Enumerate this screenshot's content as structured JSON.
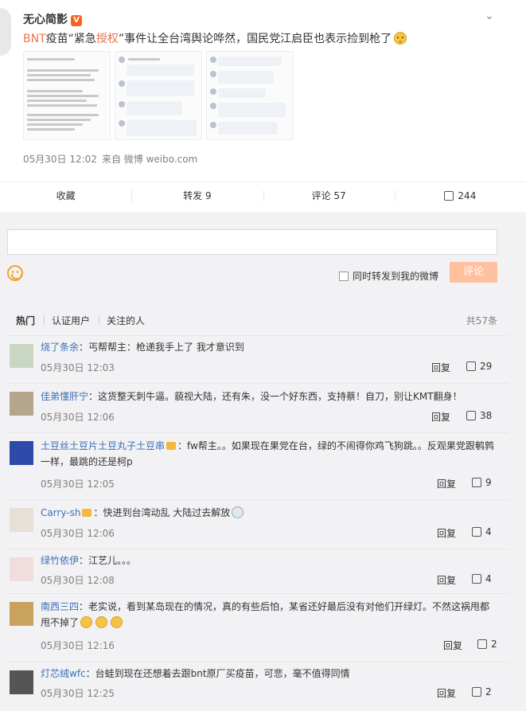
{
  "post": {
    "author": "无心简影",
    "badge": "V",
    "headline_prefix": "BNT",
    "headline_mid1": "疫苗“紧急",
    "headline_hl": "授权",
    "headline_rest": "”事件让全台湾舆论哗然，国民党江启臣也表示捡到枪了",
    "timestamp": "05月30日 12:02",
    "source": "来自 微博 weibo.com",
    "thumb1_text": "及接能急接權使用。反與接量正是否而Moderna 都會在說明中來建已通過檢經緊急授權使用。請問舞時事發者：請與和台製時 Pfizer-BioNTech疫苗送不肯已經請勿緊急授權使用？為什麼是BModerna 疫苗未通過期接緊急授權使用？"
  },
  "actions": {
    "collect": "收藏",
    "repost": "转发 9",
    "comment": "评论 57",
    "like": "244"
  },
  "composer": {
    "forward_label": "同时转发到我的微博",
    "submit_label": "评论"
  },
  "sort": {
    "hot": "热门",
    "verified": "认证用户",
    "following": "关注的人",
    "total": "共57条"
  },
  "comments": [
    {
      "user": "烧了条余",
      "text": "：丐帮帮主：枪递我手上了 我才意识到",
      "time": "05月30日 12:03",
      "reply": "回复",
      "likes": "29"
    },
    {
      "user": "佳弟懂肝宁",
      "text": "：这货整天刺牛逼。藐视大陆，还有朱，没一个好东西，支持蔡！自刀，别让KMT翻身！",
      "time": "05月30日 12:06",
      "reply": "回复",
      "likes": "38"
    },
    {
      "user": "土豆丝土豆片土豆丸子土豆串",
      "text": "：fw帮主。。如果现在果党在台，绿的不闹得你鸡飞狗跳。。反观果党跟鹌鹑一样，最跳的还是柯p",
      "time": "05月30日 12:05",
      "reply": "回复",
      "likes": "9"
    },
    {
      "user": "Carry-sh",
      "text": "：快进到台湾动乱 大陆过去解放",
      "time": "05月30日 12:06",
      "reply": "回复",
      "likes": "4"
    },
    {
      "user": "绿竹依伊",
      "text": "：江艺儿。。。",
      "time": "05月30日 12:08",
      "reply": "回复",
      "likes": "4"
    },
    {
      "user": "南西三四",
      "text": "：老实说，看到某岛现在的情况，真的有些后怕，某省还好最后没有对他们开绿灯。不然这祸甩都甩不掉了",
      "time": "05月30日 12:16",
      "reply": "回复",
      "likes": "2"
    },
    {
      "user": "灯芯绒wfc",
      "text": "：台蛙到现在还想着去跟bnt原厂买疫苗，可悲，毫不值得同情",
      "time": "05月30日 12:25",
      "reply": "回复",
      "likes": "2"
    }
  ]
}
